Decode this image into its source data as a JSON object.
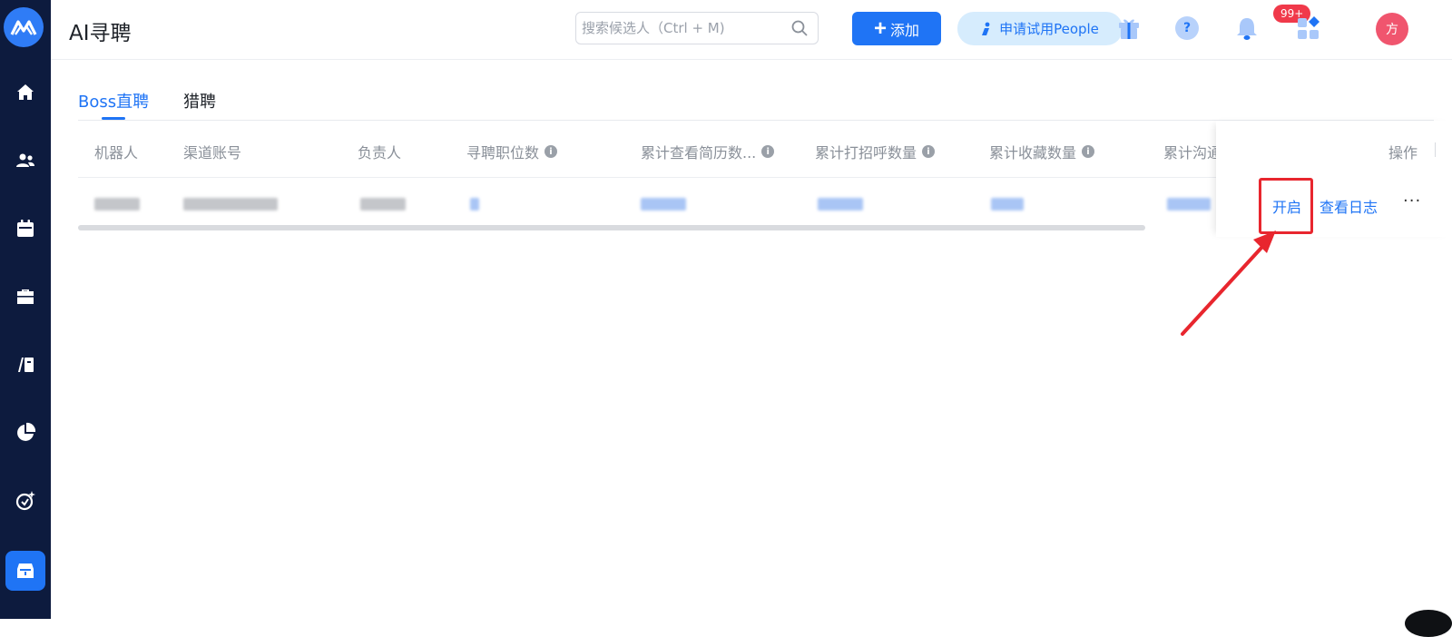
{
  "app": {
    "page_title": "AI寻聘"
  },
  "header": {
    "search_placeholder": "搜索候选人（Ctrl + M)",
    "add_label": "添加",
    "trial_label": "申请试用People",
    "notification_count": "99+",
    "avatar_text": "方"
  },
  "sidebar": {
    "items": [
      "home-icon",
      "contacts-icon",
      "calendar-icon",
      "briefcase-icon",
      "library-icon",
      "pie-chart-icon",
      "ai-sparkle-icon",
      "inbox-icon"
    ],
    "active_index": 7
  },
  "tabs": [
    {
      "label": "Boss直聘",
      "active": true
    },
    {
      "label": "猎聘",
      "active": false
    }
  ],
  "table": {
    "columns": [
      "机器人",
      "渠道账号",
      "负责人",
      "寻聘职位数",
      "累计查看简历数...",
      "累计打招呼数量",
      "累计收藏数量",
      "累计沟通"
    ],
    "operations_header": "操作",
    "actions": {
      "enable": "开启",
      "view_log": "查看日志",
      "more": "···"
    }
  },
  "colors": {
    "accent": "#1f74f5",
    "sidebar": "#0d1b3e",
    "highlight": "#e8262e"
  }
}
